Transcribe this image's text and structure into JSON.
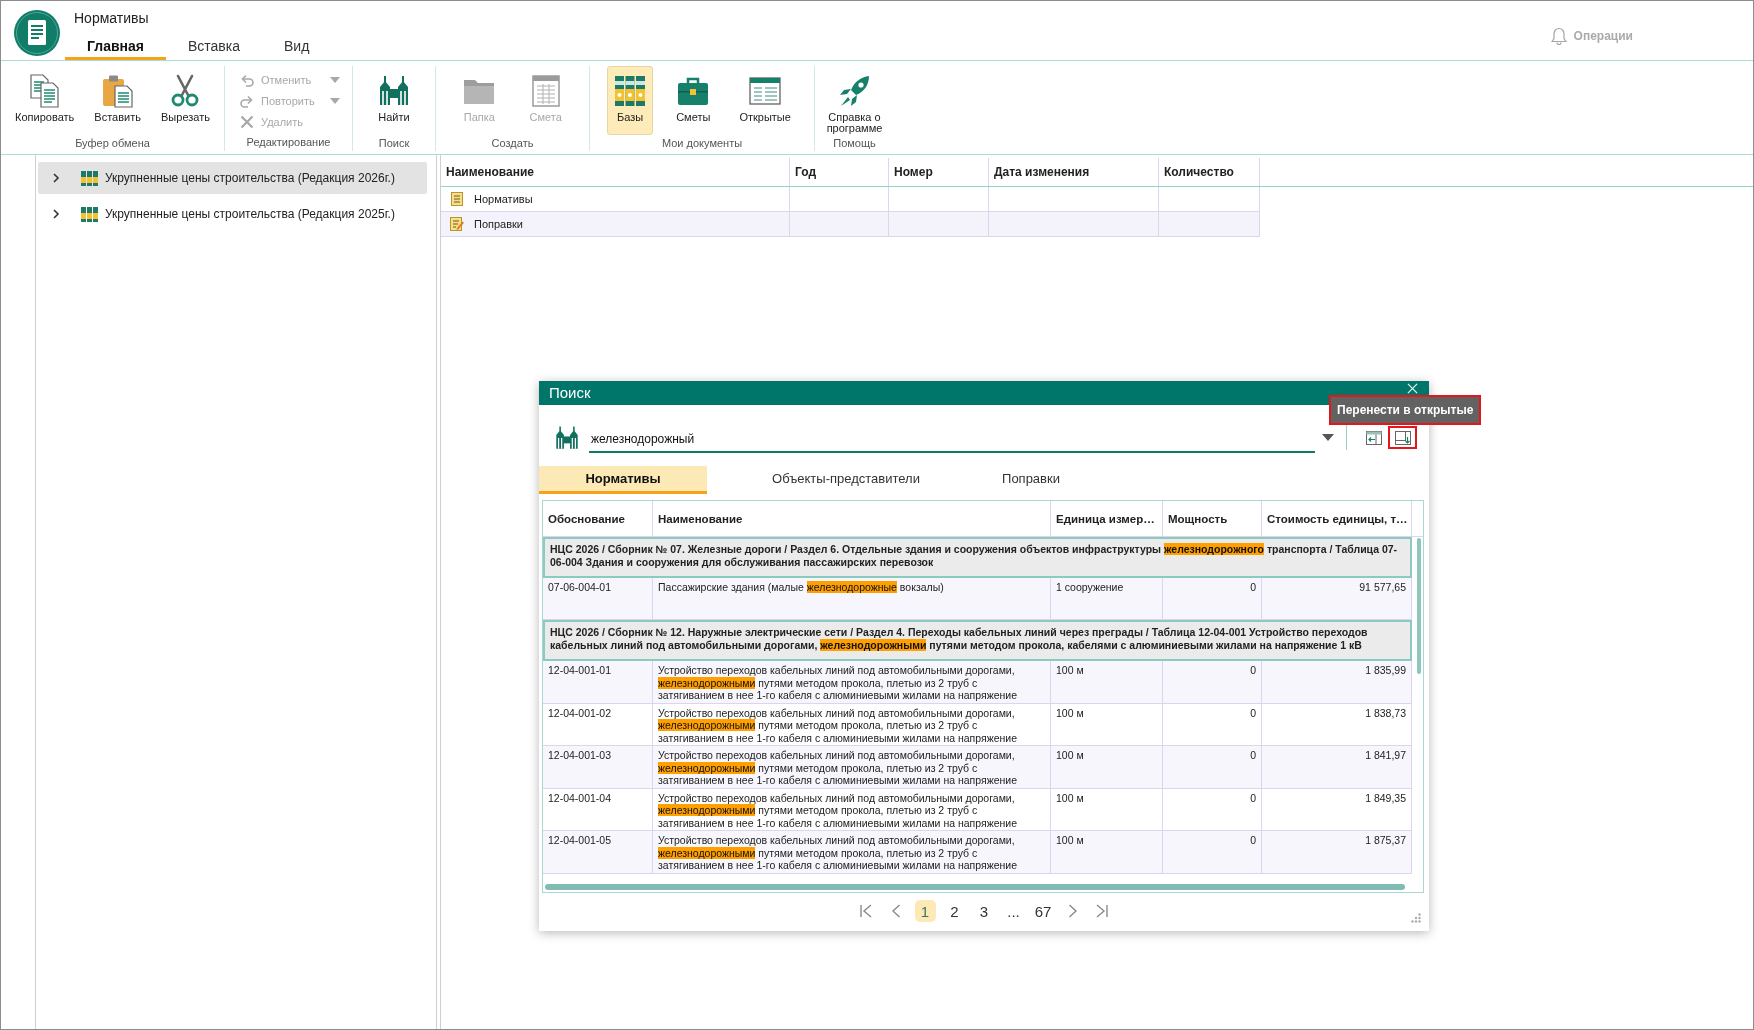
{
  "app": {
    "title": "Нормативы",
    "tabs": [
      {
        "label": "Главная",
        "selected": true
      },
      {
        "label": "Вставка",
        "selected": false
      },
      {
        "label": "Вид",
        "selected": false
      }
    ],
    "operations": "Операции"
  },
  "ribbon": [
    {
      "label": "Буфер обмена",
      "kind": "large",
      "items": [
        {
          "label": "Копировать",
          "disabled": false
        },
        {
          "label": "Вставить",
          "disabled": false
        },
        {
          "label": "Вырезать",
          "disabled": false
        }
      ]
    },
    {
      "label": "Редактирование",
      "kind": "small",
      "items": [
        {
          "label": "Отменить",
          "disabled": true,
          "dropdown": true
        },
        {
          "label": "Повторить",
          "disabled": true,
          "dropdown": true
        },
        {
          "label": "Удалить",
          "disabled": true,
          "dropdown": false
        }
      ]
    },
    {
      "label": "Поиск",
      "kind": "large",
      "items": [
        {
          "label": "Найти",
          "disabled": false
        }
      ]
    },
    {
      "label": "Создать",
      "kind": "large",
      "items": [
        {
          "label": "Папка",
          "disabled": true
        },
        {
          "label": "Смета",
          "disabled": true
        }
      ]
    },
    {
      "label": "Мои документы",
      "kind": "large",
      "items": [
        {
          "label": "Базы",
          "disabled": false,
          "selected": true
        },
        {
          "label": "Сметы",
          "disabled": false,
          "selected": false
        },
        {
          "label": "Открытые",
          "disabled": false,
          "selected": false
        }
      ]
    },
    {
      "label": "Помощь",
      "kind": "large",
      "items": [
        {
          "label": "Справка о программе",
          "disabled": false
        }
      ]
    }
  ],
  "tree": {
    "items": [
      {
        "label": "Укрупненные цены строительства (Редакция 2026г.)",
        "selected": true,
        "expanded": false
      },
      {
        "label": "Укрупненные цены строительства (Редакция 2025г.)",
        "selected": false,
        "expanded": false
      }
    ]
  },
  "documents": {
    "columns": [
      "Наименование",
      "Год",
      "Номер",
      "Дата изменения",
      "Количество"
    ],
    "rows": [
      {
        "name": "Нормативы"
      },
      {
        "name": "Поправки"
      }
    ]
  },
  "search_dialog": {
    "title": "Поиск",
    "query": "железнодорожный",
    "tools": [
      {
        "marked": false
      },
      {
        "marked": true,
        "tooltip": "Перенести в открытые"
      }
    ],
    "tabs": [
      {
        "label": "Нормативы",
        "selected": true
      },
      {
        "label": "Объекты-представители",
        "selected": false
      },
      {
        "label": "Поправки",
        "selected": false
      }
    ],
    "table": {
      "columns": [
        "Обоснование",
        "Наименование",
        "Единица измер…",
        "Мощность",
        "Стоимость единицы, т…"
      ],
      "rows": [
        {
          "kind": "group",
          "title": [
            {
              "text": "НЦС 2026 / Сборник № 07. Железные дороги / Раздел 6. Отдельные здания и сооружения объектов инфраструктуры ",
              "highlight": false
            },
            {
              "text": "железнодорожного",
              "highlight": true
            },
            {
              "text": " транспорта / Таблица 07-06-004 Здания и сооружения для обслуживания пассажирских перевозок",
              "highlight": false
            }
          ]
        },
        {
          "kind": "item",
          "code": "07-06-004-01",
          "name": [
            {
              "text": "Пассажирские здания (малые ",
              "highlight": false
            },
            {
              "text": "железнодорожные",
              "highlight": true
            },
            {
              "text": " вокзалы)",
              "highlight": false
            }
          ],
          "unit": "1 сооружение",
          "capacity": "0",
          "cost": "91 577,65"
        },
        {
          "kind": "group",
          "title": [
            {
              "text": "НЦС 2026 / Сборник № 12. Наружные электрические сети / Раздел 4. Переходы кабельных линий через преграды / Таблица 12-04-001 Устройство переходов кабельных линий под автомобильными дорогами, ",
              "highlight": false
            },
            {
              "text": "железнодорожными",
              "highlight": true
            },
            {
              "text": " путями методом прокола, кабелями с алюминиевыми жилами на напряжение 1 кВ",
              "highlight": false
            }
          ]
        },
        {
          "kind": "item",
          "code": "12-04-001-01",
          "name": [
            {
              "text": "Устройство переходов кабельных линий под автомобильными дорогами, ",
              "highlight": false
            },
            {
              "text": "железнодорожными",
              "highlight": true
            },
            {
              "text": " путями методом прокола, плетью из 2 труб с затягиванием в нее 1-го кабеля с алюминиевыми жилами на напряжение",
              "highlight": false
            }
          ],
          "unit": "100 м",
          "capacity": "0",
          "cost": "1 835,99"
        },
        {
          "kind": "item",
          "code": "12-04-001-02",
          "name": [
            {
              "text": "Устройство переходов кабельных линий под автомобильными дорогами, ",
              "highlight": false
            },
            {
              "text": "железнодорожными",
              "highlight": true
            },
            {
              "text": " путями методом прокола, плетью из 2 труб с затягиванием в нее 1-го кабеля с алюминиевыми жилами на напряжение",
              "highlight": false
            }
          ],
          "unit": "100 м",
          "capacity": "0",
          "cost": "1 838,73"
        },
        {
          "kind": "item",
          "code": "12-04-001-03",
          "name": [
            {
              "text": "Устройство переходов кабельных линий под автомобильными дорогами, ",
              "highlight": false
            },
            {
              "text": "железнодорожными",
              "highlight": true
            },
            {
              "text": " путями методом прокола, плетью из 2 труб с затягиванием в нее 1-го кабеля с алюминиевыми жилами на напряжение",
              "highlight": false
            }
          ],
          "unit": "100 м",
          "capacity": "0",
          "cost": "1 841,97"
        },
        {
          "kind": "item",
          "code": "12-04-001-04",
          "name": [
            {
              "text": "Устройство переходов кабельных линий под автомобильными дорогами, ",
              "highlight": false
            },
            {
              "text": "железнодорожными",
              "highlight": true
            },
            {
              "text": " путями методом прокола, плетью из 2 труб с затягиванием в нее 1-го кабеля с алюминиевыми жилами на напряжение",
              "highlight": false
            }
          ],
          "unit": "100 м",
          "capacity": "0",
          "cost": "1 849,35"
        },
        {
          "kind": "item",
          "code": "12-04-001-05",
          "name": [
            {
              "text": "Устройство переходов кабельных линий под автомобильными дорогами, ",
              "highlight": false
            },
            {
              "text": "железнодорожными",
              "highlight": true
            },
            {
              "text": " путями методом прокола, плетью из 2 труб с затягиванием в нее 1-го кабеля с алюминиевыми жилами на напряжение",
              "highlight": false
            }
          ],
          "unit": "100 м",
          "capacity": "0",
          "cost": "1 875,37"
        }
      ]
    },
    "pagination": {
      "pages": [
        {
          "label": "1",
          "selected": true
        },
        {
          "label": "2",
          "selected": false
        },
        {
          "label": "3",
          "selected": false
        },
        {
          "label": "...",
          "selected": false
        },
        {
          "label": "67",
          "selected": false
        }
      ]
    }
  }
}
